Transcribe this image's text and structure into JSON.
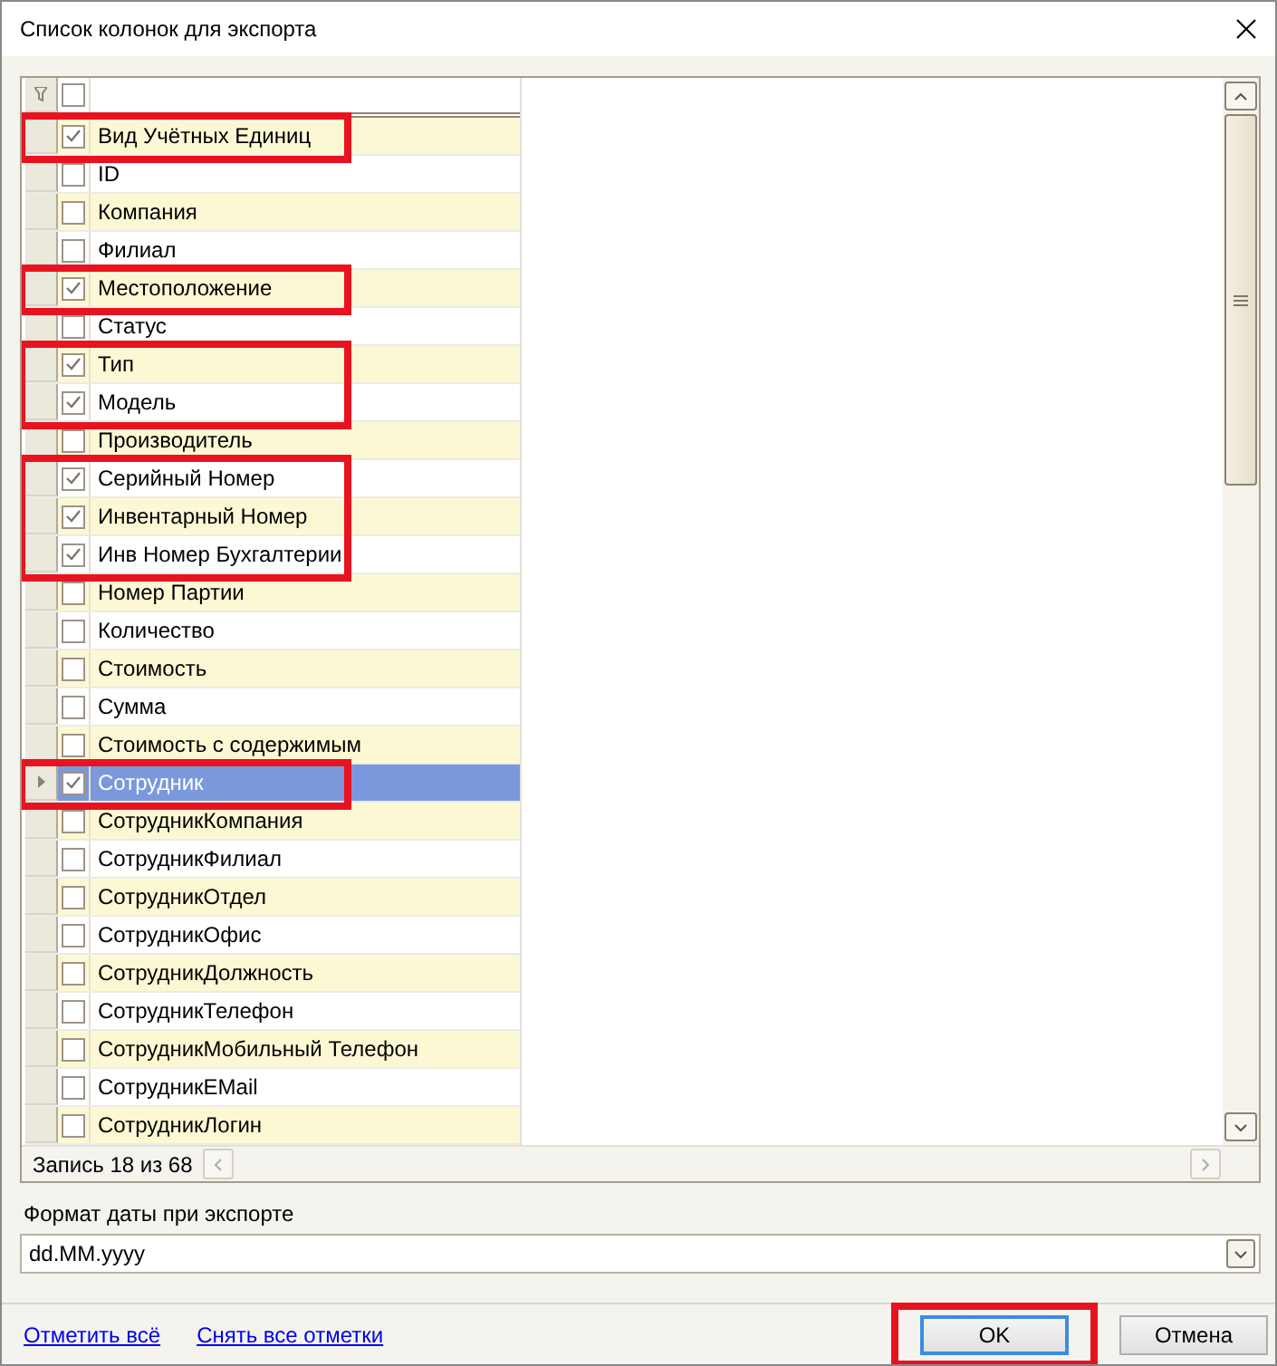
{
  "window": {
    "title": "Список колонок для экспорта"
  },
  "grid": {
    "header_checkbox": {
      "checked": false
    },
    "rows": [
      {
        "label": "Вид Учётных Единиц",
        "checked": true,
        "selected": false,
        "highlighted": true
      },
      {
        "label": "ID",
        "checked": false,
        "selected": false,
        "highlighted": false
      },
      {
        "label": "Компания",
        "checked": false,
        "selected": false,
        "highlighted": false
      },
      {
        "label": "Филиал",
        "checked": false,
        "selected": false,
        "highlighted": false
      },
      {
        "label": "Местоположение",
        "checked": true,
        "selected": false,
        "highlighted": true
      },
      {
        "label": "Статус",
        "checked": false,
        "selected": false,
        "highlighted": false
      },
      {
        "label": "Тип",
        "checked": true,
        "selected": false,
        "highlighted": true
      },
      {
        "label": "Модель",
        "checked": true,
        "selected": false,
        "highlighted": true
      },
      {
        "label": "Производитель",
        "checked": false,
        "selected": false,
        "highlighted": false
      },
      {
        "label": "Серийный Номер",
        "checked": true,
        "selected": false,
        "highlighted": true
      },
      {
        "label": "Инвентарный Номер",
        "checked": true,
        "selected": false,
        "highlighted": true
      },
      {
        "label": "Инв Номер Бухгалтерии",
        "checked": true,
        "selected": false,
        "highlighted": true
      },
      {
        "label": "Номер Партии",
        "checked": false,
        "selected": false,
        "highlighted": false
      },
      {
        "label": "Количество",
        "checked": false,
        "selected": false,
        "highlighted": false
      },
      {
        "label": "Стоимость",
        "checked": false,
        "selected": false,
        "highlighted": false
      },
      {
        "label": "Сумма",
        "checked": false,
        "selected": false,
        "highlighted": false
      },
      {
        "label": "Стоимость с содержимым",
        "checked": false,
        "selected": false,
        "highlighted": false
      },
      {
        "label": "Сотрудник",
        "checked": true,
        "selected": true,
        "highlighted": true
      },
      {
        "label": "СотрудникКомпания",
        "checked": false,
        "selected": false,
        "highlighted": false
      },
      {
        "label": "СотрудникФилиал",
        "checked": false,
        "selected": false,
        "highlighted": false
      },
      {
        "label": "СотрудникОтдел",
        "checked": false,
        "selected": false,
        "highlighted": false
      },
      {
        "label": "СотрудникОфис",
        "checked": false,
        "selected": false,
        "highlighted": false
      },
      {
        "label": "СотрудникДолжность",
        "checked": false,
        "selected": false,
        "highlighted": false
      },
      {
        "label": "СотрудникТелефон",
        "checked": false,
        "selected": false,
        "highlighted": false
      },
      {
        "label": "СотрудникМобильный Телефон",
        "checked": false,
        "selected": false,
        "highlighted": false
      },
      {
        "label": "СотрудникEMail",
        "checked": false,
        "selected": false,
        "highlighted": false
      },
      {
        "label": "СотрудникЛогин",
        "checked": false,
        "selected": false,
        "highlighted": false
      }
    ],
    "record_counter": "Запись 18 из 68"
  },
  "date_format": {
    "label": "Формат даты при экспорте",
    "value": "dd.MM.yyyy"
  },
  "links": [
    "Отметить всё",
    "Снять все отметки"
  ],
  "buttons": [
    {
      "label": "OK",
      "highlighted": true,
      "default": true
    },
    {
      "label": "Отмена",
      "highlighted": false,
      "default": false
    }
  ]
}
